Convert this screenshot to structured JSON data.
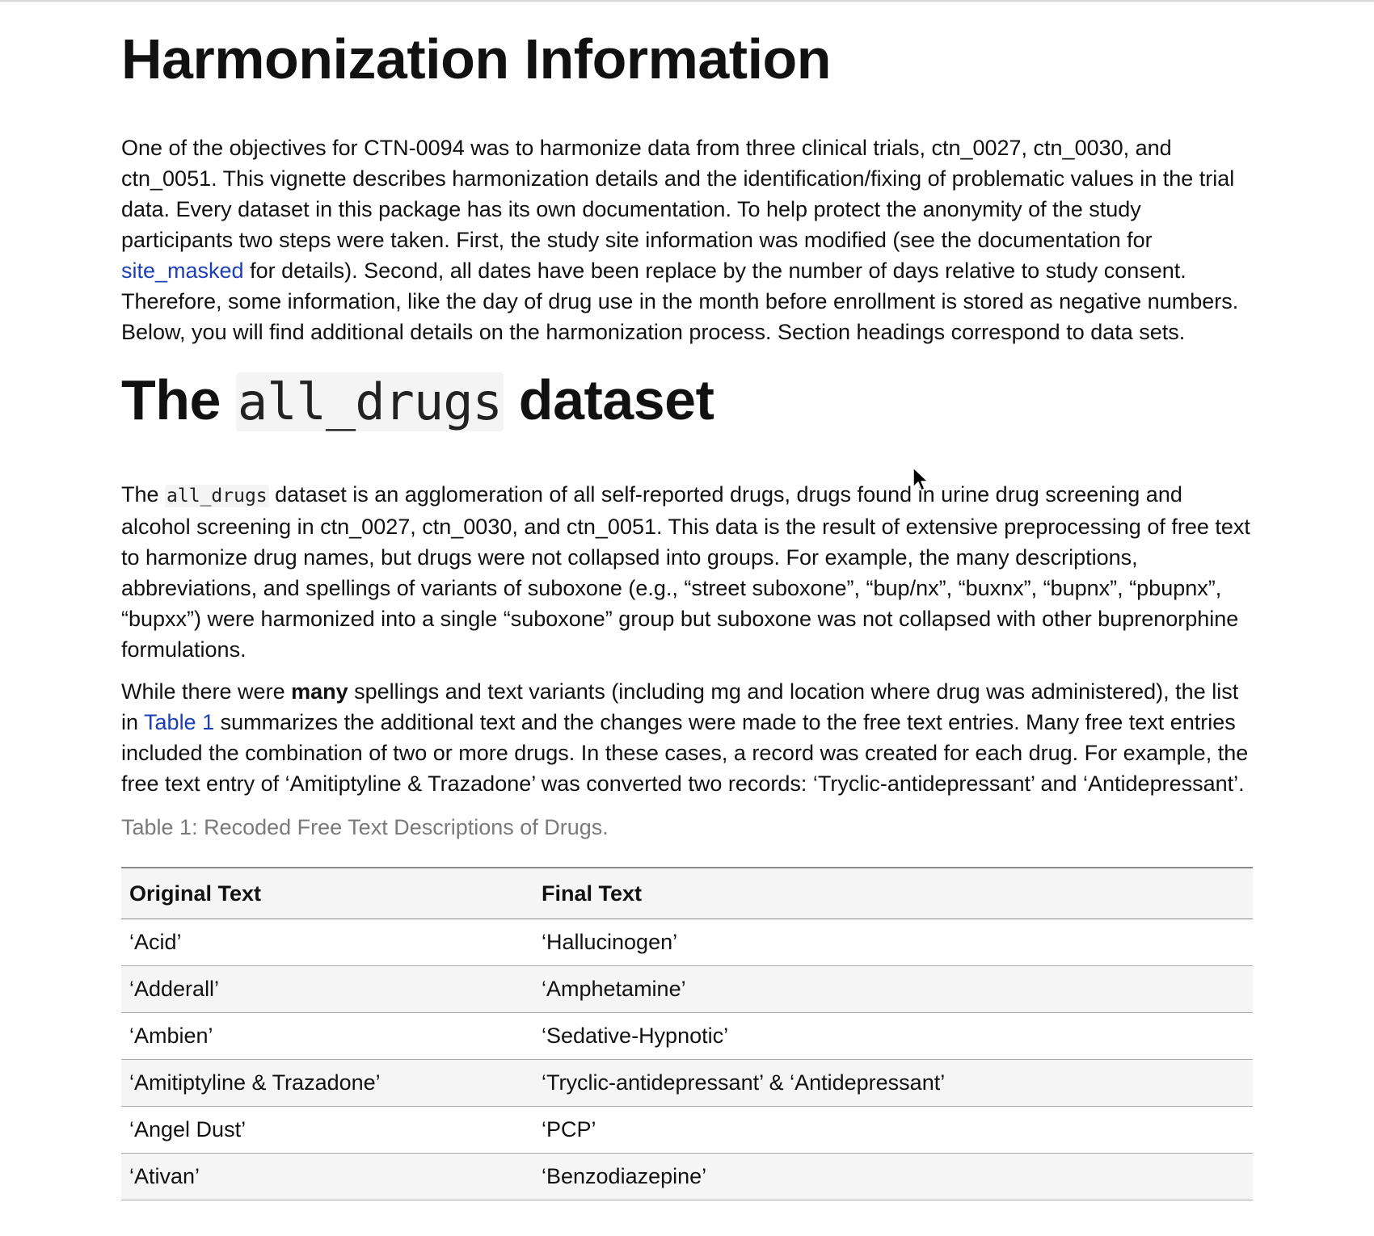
{
  "title": "Harmonization Information",
  "intro": {
    "part1": "One of the objectives for CTN-0094 was to harmonize data from three clinical trials, ctn_0027, ctn_0030, and ctn_0051. This vignette describes harmonization details and the identification/fixing of problematic values in the trial data. Every dataset in this package has its own documentation. To help protect the anonymity of the study participants two steps were taken. First, the study site information was modified (see the documentation for ",
    "link": "site_masked",
    "part2": " for details). Second, all dates have been replace by the number of days relative to study consent. Therefore, some information, like the day of drug use in the month before enrollment is stored as negative numbers. Below, you will find additional details on the harmonization process. Section headings correspond to data sets."
  },
  "section": {
    "heading_prefix": "The ",
    "heading_code": "all_drugs",
    "heading_suffix": " dataset",
    "p1": {
      "prefix": "The ",
      "code": "all_drugs",
      "text": " dataset is an agglomeration of all self-reported drugs, drugs found in urine drug screening and alcohol screening in ctn_0027, ctn_0030, and ctn_0051. This data is the result of extensive preprocessing of free text to harmonize drug names, but drugs were not collapsed into groups. For example, the many descriptions, abbreviations, and spellings of variants of suboxone (e.g., “street suboxone”, “bup/nx”, “buxnx”, “bupnx”, “pbupnx”, “bupxx”) were harmonized into a single “suboxone” group but suboxone was not collapsed with other buprenorphine formulations."
    },
    "p2": {
      "part1": "While there were ",
      "bold": "many",
      "part2": " spellings and text variants (including mg and location where drug was administered), the list in ",
      "link": "Table 1",
      "part3": " summarizes the additional text and the changes were made to the free text entries. Many free text entries included the combination of two or more drugs. In these cases, a record was created for each drug. For example, the free text entry of ‘Amitiptyline & Trazadone’ was converted two records: ‘Tryclic-antidepressant’ and ‘Antidepressant’."
    },
    "caption": "Table 1: Recoded Free Text Descriptions of Drugs."
  },
  "table": {
    "headers": [
      "Original Text",
      "Final Text"
    ],
    "rows": [
      [
        "‘Acid’",
        "‘Hallucinogen’"
      ],
      [
        "‘Adderall’",
        "‘Amphetamine’"
      ],
      [
        "‘Ambien’",
        "‘Sedative-Hypnotic’"
      ],
      [
        "‘Amitiptyline & Trazadone’",
        "‘Tryclic-antidepressant’ & ‘Antidepressant’"
      ],
      [
        "‘Angel Dust’",
        "‘PCP’"
      ],
      [
        "‘Ativan’",
        "‘Benzodiazepine’"
      ]
    ]
  }
}
